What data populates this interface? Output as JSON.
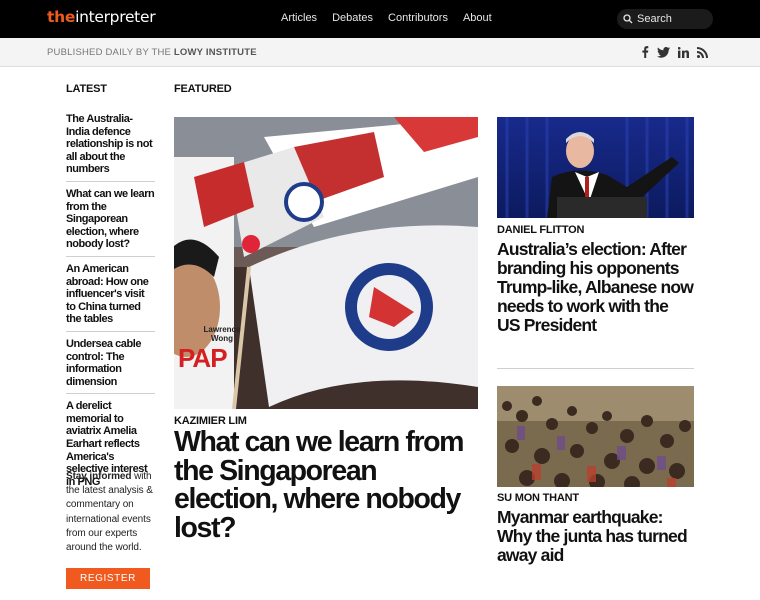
{
  "brand": {
    "part1": "the",
    "part2": "interpreter"
  },
  "nav": [
    "Articles",
    "Debates",
    "Contributors",
    "About"
  ],
  "search": {
    "label": "Search"
  },
  "subbar": {
    "published_prefix": "PUBLISHED DAILY BY THE ",
    "published_org": "LOWY INSTITUTE"
  },
  "social": [
    "facebook-icon",
    "twitter-icon",
    "linkedin-icon",
    "rss-icon"
  ],
  "latest": {
    "heading": "LATEST",
    "items": [
      "The Australia-India defence relationship is not all about the numbers",
      "What can we learn from the Singaporean election, where nobody lost?",
      "An American abroad: How one influencer's visit to China turned the tables",
      "Undersea cable control: The information dimension",
      "A derelict memorial to aviatrix Amelia Earhart reflects America's selective interest in PNG"
    ]
  },
  "newsletter": {
    "bold": "Stay informed",
    "text": " with the latest analysis & commentary on international events from our experts around the world.",
    "button": "REGISTER"
  },
  "featured": {
    "heading": "FEATURED",
    "main": {
      "author": "KAZIMIER LIM",
      "title": "What can we learn from the Singaporean election, where nobody lost?",
      "poster_name": "Lawrence Wong",
      "poster_party": "PAP"
    },
    "side": [
      {
        "author": "DANIEL FLITTON",
        "title": "Australia’s election: After branding his opponents Trump-like, Albanese now needs to work with the US President"
      },
      {
        "author": "SU MON THANT",
        "title": "Myanmar earthquake: Why the junta has turned away aid"
      }
    ]
  },
  "colors": {
    "accent": "#f05a1e",
    "topbar": "#000000"
  }
}
